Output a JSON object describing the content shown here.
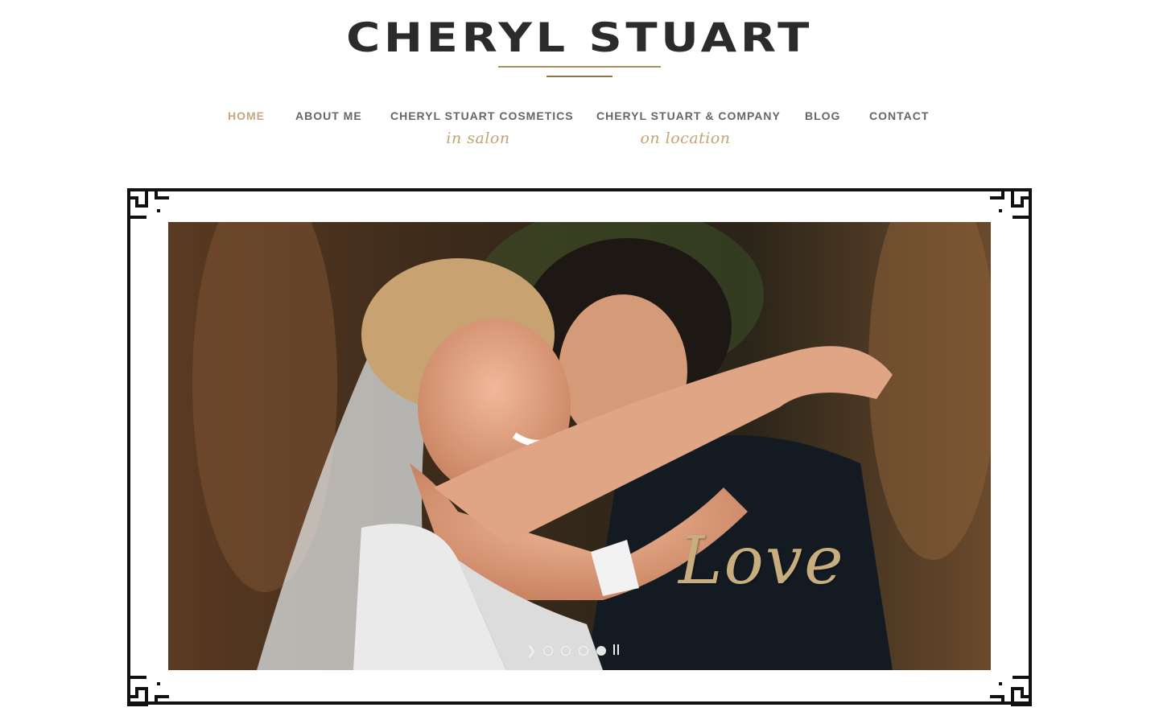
{
  "site": {
    "logo_text": "CHERYL STUART"
  },
  "nav": {
    "items": [
      {
        "label": "HOME",
        "sub": ""
      },
      {
        "label": "ABOUT ME",
        "sub": ""
      },
      {
        "label": "CHERYL STUART COSMETICS",
        "sub": "in salon"
      },
      {
        "label": "CHERYL STUART & COMPANY",
        "sub": "on location"
      },
      {
        "label": "BLOG",
        "sub": ""
      },
      {
        "label": "CONTACT",
        "sub": ""
      }
    ],
    "active_index": 0
  },
  "slider": {
    "caption": "Love",
    "slide_count": 4,
    "active_slide": 4,
    "prev_icon": "chevron-right-icon",
    "pause_icon": "pause-icon"
  },
  "colors": {
    "accent_gold": "#c6a97a",
    "nav_text": "#666666",
    "logo_text": "#2b2b2b",
    "frame": "#111111"
  }
}
